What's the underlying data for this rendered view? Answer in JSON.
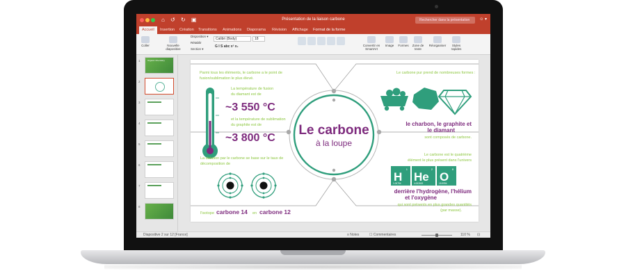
{
  "window": {
    "title": "Présentation de la liaison carbone",
    "quick_access": "⌂ ↺ ↻ ▣",
    "search_placeholder": "Rechercher dans la présentation",
    "account_icons": "☺ ▾"
  },
  "tabs": [
    {
      "label": "Accueil"
    },
    {
      "label": "Insertion"
    },
    {
      "label": "Création"
    },
    {
      "label": "Transitions"
    },
    {
      "label": "Animations"
    },
    {
      "label": "Diaporama"
    },
    {
      "label": "Révision"
    },
    {
      "label": "Affichage"
    },
    {
      "label": "Format de la forme"
    }
  ],
  "ribbon": {
    "paste": "Coller",
    "new_slide": "Nouvelle diapositive",
    "layout": "Disposition ▾",
    "reset": "Rétablir",
    "section": "Section ▾",
    "font_name": "Calibri (Body)",
    "font_size": "18",
    "format_buttons": "G  I  S  abc  x²  x₂",
    "convert_smartart": "Convertir en SmartArt",
    "image": "Image",
    "shapes": "Formes",
    "text_box": "Zone de texte",
    "arrange": "Réorganiser",
    "quick_styles": "Styles rapides"
  },
  "thumbnails": [
    {
      "num": "1",
      "title": "Organic Chemistry"
    },
    {
      "num": "2",
      "title": ""
    },
    {
      "num": "3",
      "title": ""
    },
    {
      "num": "4",
      "title": ""
    },
    {
      "num": "5",
      "title": ""
    },
    {
      "num": "6",
      "title": ""
    },
    {
      "num": "7",
      "title": ""
    },
    {
      "num": "8",
      "title": ""
    }
  ],
  "slide": {
    "center_title": "Le carbone",
    "center_subtitle": "à la loupe",
    "tl_intro_1": "Parmi tous les éléments, le carbone a le point de",
    "tl_intro_2": "fusion/sublimation le plus élevé.",
    "temp_label_1": "La température de fusion",
    "temp_label_2": "du diamant est de",
    "temp_value_1": "~3 550 °C",
    "temp_label_3": "et la température de sublimation",
    "temp_label_4": "du graphite est de",
    "temp_value_2": "~3 800 °C",
    "dating_1": "La datation par le carbone se base sur le taux de",
    "dating_2": "décomposition de",
    "isotope_pre": "l'isotope",
    "isotope_a": "carbone 14",
    "isotope_mid": "en",
    "isotope_b": "carbone 12",
    "forms_intro": "Le carbone pur prend de nombreuses formes :",
    "forms_1": "le charbon, le graphite et",
    "forms_2": "le diamant",
    "forms_3": "sont composés de carbone.",
    "abund_1": "Le carbone est le quatrième",
    "abund_2": "élément le plus présent dans l'univers",
    "elements": [
      {
        "num": "1",
        "sym": "H",
        "mass": "1.00794"
      },
      {
        "num": "2",
        "sym": "He",
        "mass": "4.002602"
      },
      {
        "num": "8",
        "sym": "O",
        "mass": "15.9994"
      }
    ],
    "abund_3": "derrière l'hydrogène, l'hélium",
    "abund_4": "et l'oxygène",
    "abund_5": "qui sont présents en plus grandes quantités",
    "abund_6": "(par masse)."
  },
  "status": {
    "slide_info": "Diapositive 2 sur 12   [France]",
    "notes": "≡ Notes",
    "comments": "☐ Commentaires",
    "zoom": "110 %",
    "fit": "⊡"
  },
  "colors": {
    "ribbon_red": "#c0402c",
    "accent_green": "#8cc63f",
    "accent_purple": "#7d2a7d",
    "accent_teal": "#2f9e7c"
  }
}
